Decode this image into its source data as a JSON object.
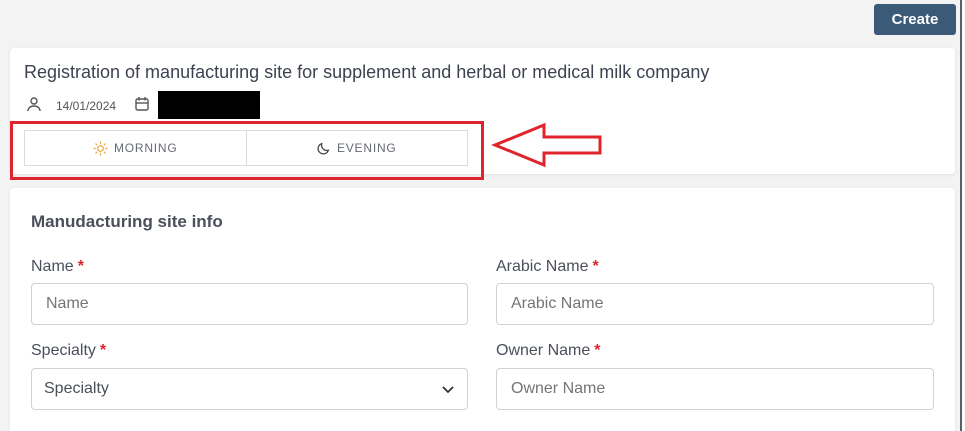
{
  "toolbar": {
    "create_label": "Create"
  },
  "header": {
    "title": "Registration of manufacturing site for supplement and herbal or medical milk company",
    "date": "14/01/2024"
  },
  "shifts": [
    {
      "label": "MORNING",
      "icon": "sun-icon"
    },
    {
      "label": "EVENING",
      "icon": "moon-icon"
    }
  ],
  "annotation": {
    "box_color": "#e0242c",
    "arrow_color": "#e0242c"
  },
  "form": {
    "section_title": "Manudacturing site info",
    "required_mark": "*",
    "fields": {
      "name": {
        "label": "Name",
        "placeholder": "Name"
      },
      "arabic_name": {
        "label": "Arabic Name",
        "placeholder": "Arabic Name"
      },
      "specialty": {
        "label": "Specialty",
        "value": "Specialty"
      },
      "owner_name": {
        "label": "Owner Name",
        "placeholder": "Owner Name"
      }
    }
  },
  "colors": {
    "primary": "#3b5a78",
    "required": "#e0242c",
    "background": "#f3f3f4"
  }
}
